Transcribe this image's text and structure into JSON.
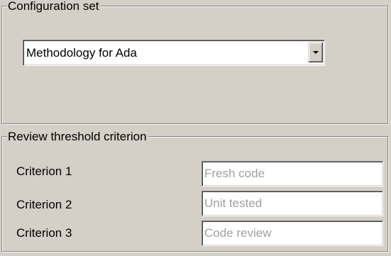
{
  "configuration_set": {
    "legend": "Configuration set",
    "selected_value": "Methodology for Ada"
  },
  "review_threshold": {
    "legend": "Review threshold criterion",
    "criteria": [
      {
        "label": "Criterion 1",
        "placeholder": "Fresh code"
      },
      {
        "label": "Criterion 2",
        "placeholder": "Unit tested"
      },
      {
        "label": "Criterion 3",
        "placeholder": "Code review"
      }
    ]
  },
  "colors": {
    "panel_background": "#d4d0c8",
    "field_background": "#ffffff",
    "placeholder_text": "#a0a0a0"
  },
  "icons": {
    "combo_button": "chevron-down-icon"
  }
}
